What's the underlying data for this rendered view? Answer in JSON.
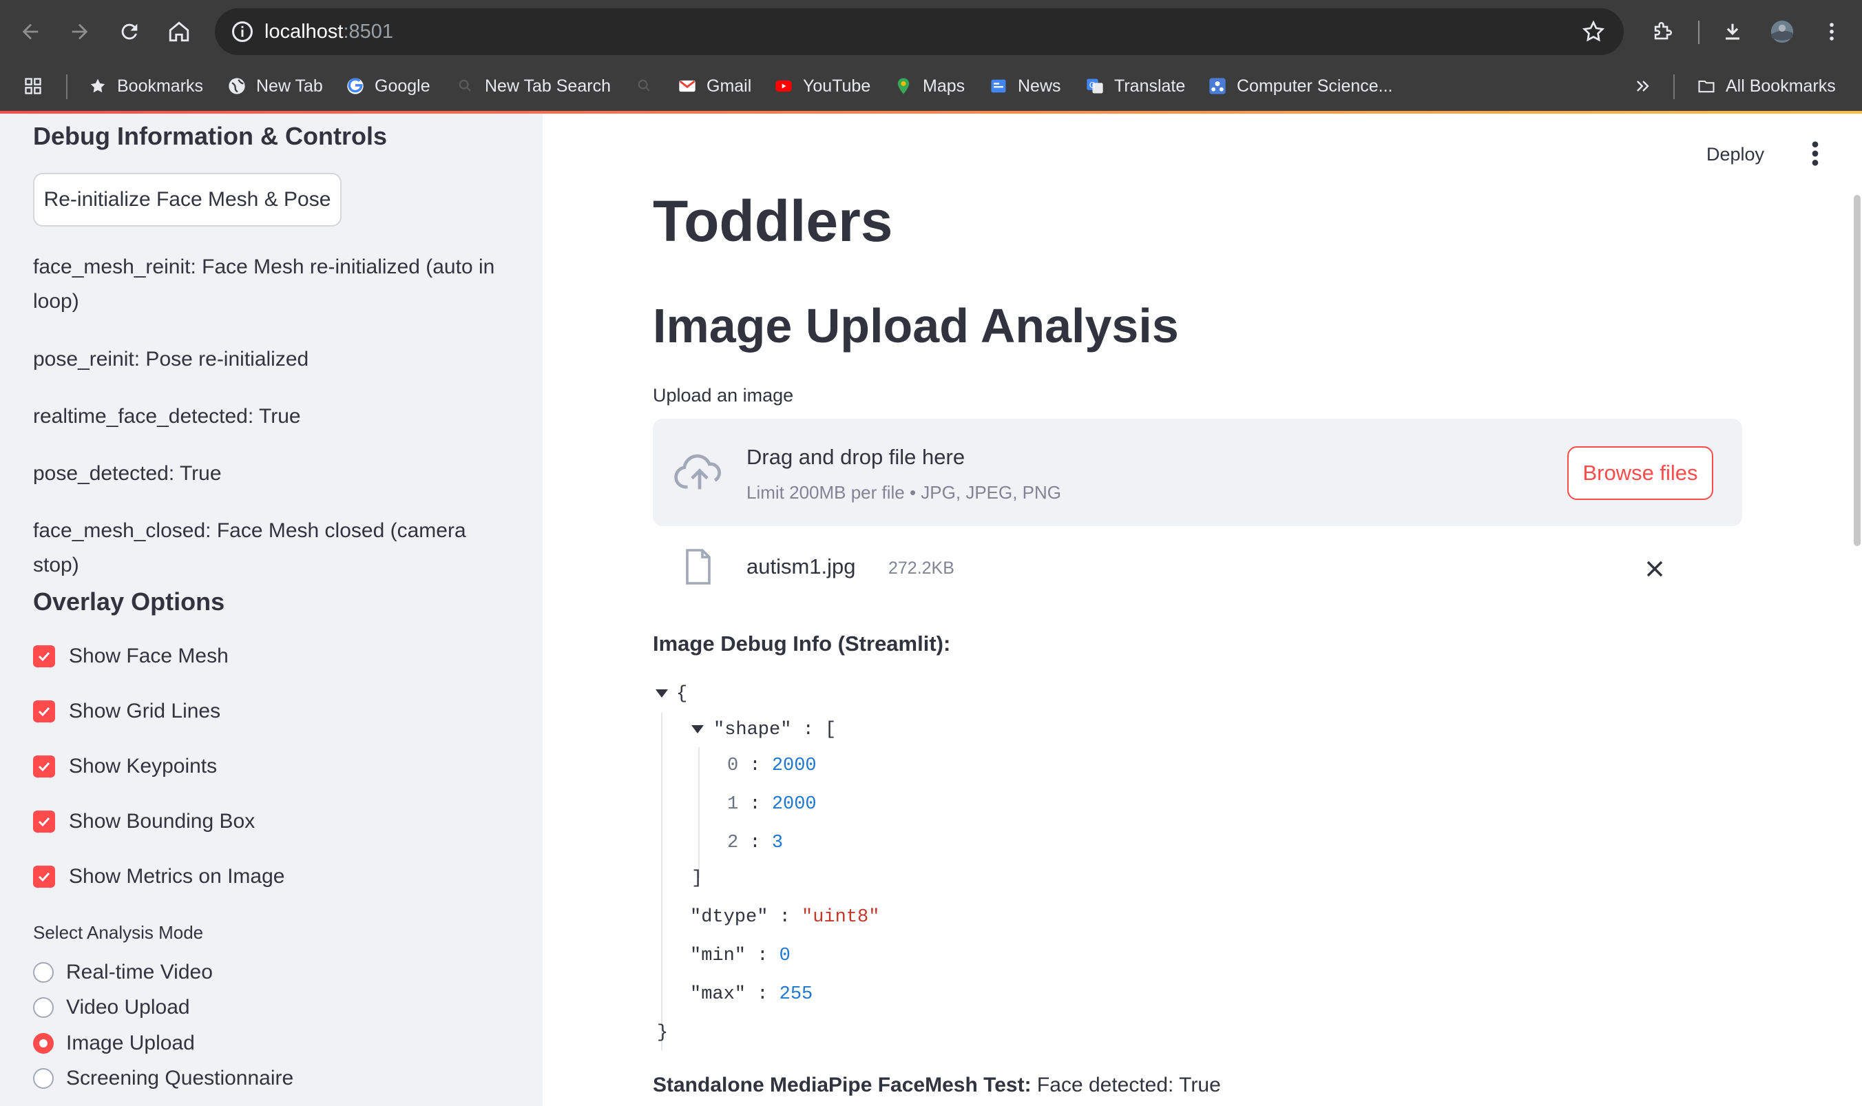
{
  "browser": {
    "url_host": "localhost",
    "url_port": ":8501",
    "bookmarks": [
      {
        "label": "Bookmarks",
        "icon": "star-icon"
      },
      {
        "label": "New Tab",
        "icon": "globe-icon"
      },
      {
        "label": "Google",
        "icon": "google-icon"
      },
      {
        "label": "New Tab Search",
        "icon": "search-icon"
      },
      {
        "label": "Gmail",
        "icon": "gmail-icon"
      },
      {
        "label": "YouTube",
        "icon": "youtube-icon"
      },
      {
        "label": "Maps",
        "icon": "maps-icon"
      },
      {
        "label": "News",
        "icon": "news-icon"
      },
      {
        "label": "Translate",
        "icon": "translate-icon"
      },
      {
        "label": "Computer Science...",
        "icon": "computer-science-icon"
      }
    ],
    "all_bookmarks": "All Bookmarks"
  },
  "sidebar": {
    "debug_title": "Debug Information & Controls",
    "reinit_button": "Re-initialize Face Mesh & Pose",
    "debug_lines": [
      "face_mesh_reinit: Face Mesh re-initialized (auto in loop)",
      "pose_reinit: Pose re-initialized",
      "realtime_face_detected: True",
      "pose_detected: True",
      "face_mesh_closed: Face Mesh closed (camera stop)"
    ],
    "overlay_title": "Overlay Options",
    "overlay_options": [
      {
        "label": "Show Face Mesh",
        "checked": true
      },
      {
        "label": "Show Grid Lines",
        "checked": true
      },
      {
        "label": "Show Keypoints",
        "checked": true
      },
      {
        "label": "Show Bounding Box",
        "checked": true
      },
      {
        "label": "Show Metrics on Image",
        "checked": true
      }
    ],
    "mode_label": "Select Analysis Mode",
    "modes": [
      {
        "label": "Real-time Video",
        "selected": false
      },
      {
        "label": "Video Upload",
        "selected": false
      },
      {
        "label": "Image Upload",
        "selected": true
      },
      {
        "label": "Screening Questionnaire",
        "selected": false
      }
    ]
  },
  "main": {
    "deploy": "Deploy",
    "title": "Toddlers",
    "subtitle": "Image Upload Analysis",
    "upload_label": "Upload an image",
    "dropzone_main": "Drag and drop file here",
    "dropzone_limit": "Limit 200MB per file • JPG, JPEG, PNG",
    "browse_button": "Browse files",
    "file_name": "autism1.jpg",
    "file_size": "272.2KB",
    "debug_title": "Image Debug Info (Streamlit):",
    "json": {
      "open": "{",
      "shape_key": "\"shape\"",
      "shape_open": "[",
      "shape": [
        {
          "index": "0",
          "value": "2000"
        },
        {
          "index": "1",
          "value": "2000"
        },
        {
          "index": "2",
          "value": "3"
        }
      ],
      "shape_close": "]",
      "dtype_key": "\"dtype\"",
      "dtype_value": "\"uint8\"",
      "min_key": "\"min\"",
      "min_value": "0",
      "max_key": "\"max\"",
      "max_value": "255",
      "close": "}",
      "colon": " : "
    },
    "standalone_label": "Standalone MediaPipe FaceMesh Test:",
    "standalone_value": " Face detected: True"
  },
  "colors": {
    "accent": "#ff4b4b",
    "sidebar_bg": "#f0f2f6",
    "text": "#31333f",
    "json_number": "#1f77d0",
    "json_string": "#c0392b"
  }
}
